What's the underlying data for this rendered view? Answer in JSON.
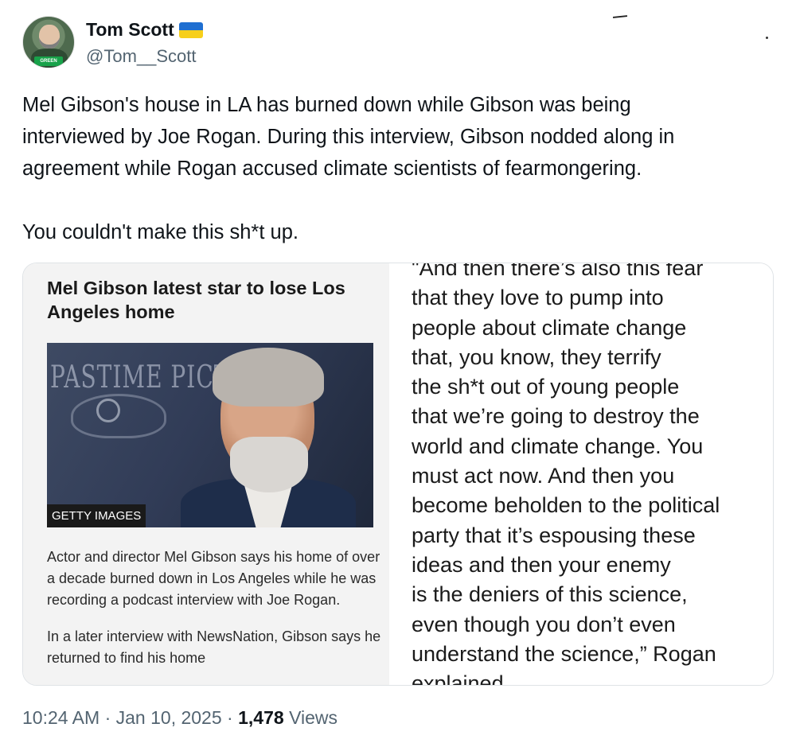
{
  "user": {
    "display_name": "Tom Scott",
    "handle": "@Tom__Scott",
    "avatar_badge": "GREEN",
    "flag_icon": "ukraine-flag-icon"
  },
  "tweet": {
    "text": "Mel Gibson's house in LA has burned down while Gibson was being\ninterviewed by Joe Rogan. During this interview, Gibson nodded along in\nagreement while Rogan accused climate scientists of fearmongering.\n\nYou couldn't make this sh*t up."
  },
  "card": {
    "article": {
      "title": "Mel Gibson latest star to lose Los Angeles home",
      "photo_logo": "PASTIME PICTURES",
      "photo_caption": "GETTY IMAGES",
      "paragraph_1": "Actor and director Mel Gibson says his home of over a decade burned down in Los Angeles while he was recording a podcast interview with Joe Rogan.",
      "paragraph_2": "In a later interview with NewsNation, Gibson says he returned to find his home"
    },
    "quote": {
      "text": "\"And then there’s also this fear\nthat they love to pump into\npeople about climate change\nthat, you know, they terrify\nthe sh*t out of young people\nthat we’re going to destroy the\nworld and climate change. You\nmust act now. And then you\nbecome beholden to the political\nparty that it’s espousing these\nideas and then your enemy\nis the deniers of this science,\neven though you don’t even\nunderstand the science,” Rogan\nexplained"
    }
  },
  "meta": {
    "time": "10:24 AM",
    "separator": "·",
    "date": "Jan 10, 2025",
    "views_count": "1,478",
    "views_label": "Views"
  },
  "colors": {
    "text_primary": "#0f1419",
    "text_secondary": "#536471",
    "card_border": "#dfe3e6",
    "flag_blue": "#1f6fd1",
    "flag_yellow": "#f7cf1a"
  }
}
